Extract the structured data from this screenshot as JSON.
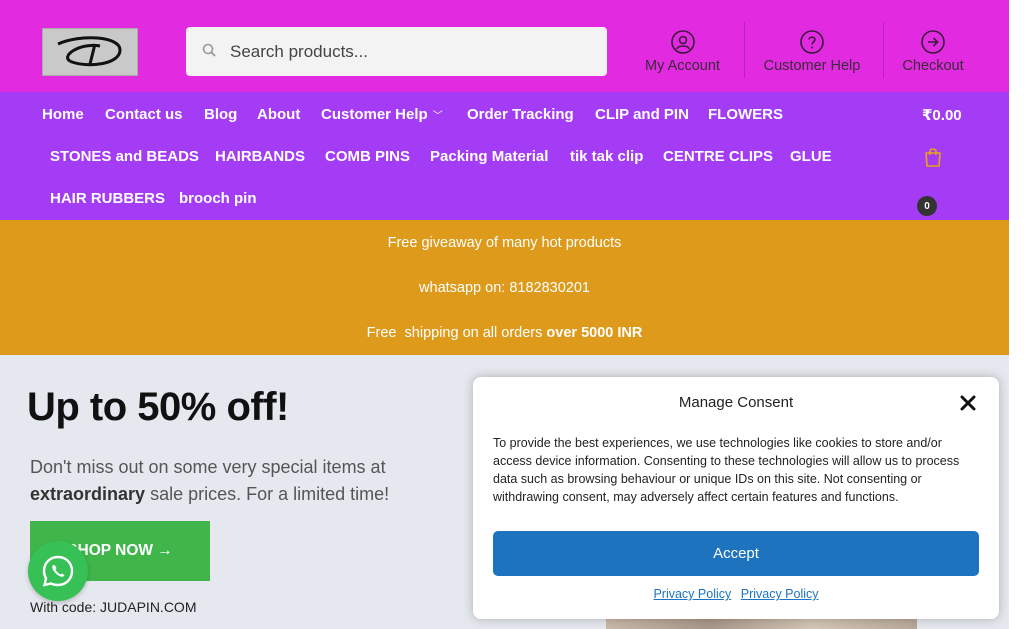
{
  "header": {
    "search_placeholder": "Search products...",
    "links": [
      {
        "label": "My Account",
        "icon": "user-circle-icon"
      },
      {
        "label": "Customer Help",
        "icon": "question-circle-icon"
      },
      {
        "label": "Checkout",
        "icon": "arrow-right-circle-icon"
      }
    ],
    "bg_color": "#e22be0"
  },
  "nav": {
    "bg_color": "#a43cf5",
    "items": [
      "Home",
      "Contact us",
      "Blog",
      "About",
      "Customer Help",
      "Order Tracking",
      "CLIP and PIN",
      "FLOWERS",
      "STONES and BEADS",
      "HAIRBANDS",
      "COMB PINS",
      "Packing Material",
      "tik tak clip",
      "CENTRE CLIPS",
      "GLUE",
      "HAIR RUBBERS",
      "brooch pin"
    ],
    "cart_total": "₹0.00",
    "cart_count": "0"
  },
  "promo": {
    "bg_color": "#dd9a1b",
    "line1": "Free giveaway of many hot products",
    "line2": "whatsapp on: 8182830201",
    "line3_prefix": "Free  shipping on all orders ",
    "line3_bold": "over 5000 INR"
  },
  "hero": {
    "title": "Up to 50% off!",
    "sub_prefix": "Don't miss out on some very special items at ",
    "sub_bold": "extraordinary",
    "sub_suffix": " sale prices. For a limited time!",
    "button_label": "SHOP NOW →",
    "code_text": "With code: JUDAPIN.COM"
  },
  "consent": {
    "title": "Manage Consent",
    "body": "To provide the best experiences, we use technologies like cookies to store and/or access device information. Consenting to these technologies will allow us to process data such as browsing behaviour or unique IDs on this site. Not consenting or withdrawing consent, may adversely affect certain features and functions.",
    "accept_label": "Accept",
    "policy_links": [
      "Privacy Policy",
      "Privacy Policy"
    ]
  }
}
